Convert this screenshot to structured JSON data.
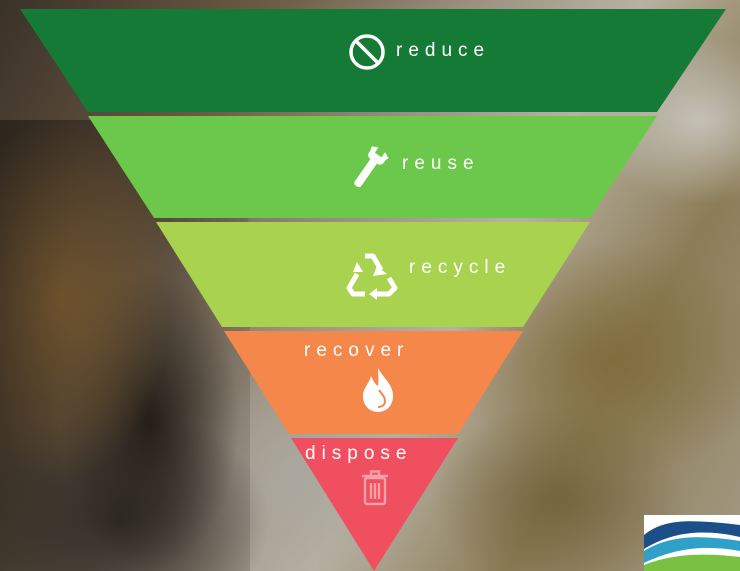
{
  "tiers": [
    {
      "label": "reduce",
      "icon": "no-entry-icon",
      "color": "#157a35"
    },
    {
      "label": "reuse",
      "icon": "wrench-icon",
      "color": "#6cc84a"
    },
    {
      "label": "recycle",
      "icon": "recycle-icon",
      "color": "#a9d24f"
    },
    {
      "label": "recover",
      "icon": "flame-icon",
      "color": "#f5874a"
    },
    {
      "label": "dispose",
      "icon": "trash-bin-icon",
      "color": "#ef4f5e"
    }
  ],
  "logo": {
    "icon": "wave-logo-icon",
    "colors": [
      "#1c4f8a",
      "#2fa0c8",
      "#7ac143"
    ]
  }
}
